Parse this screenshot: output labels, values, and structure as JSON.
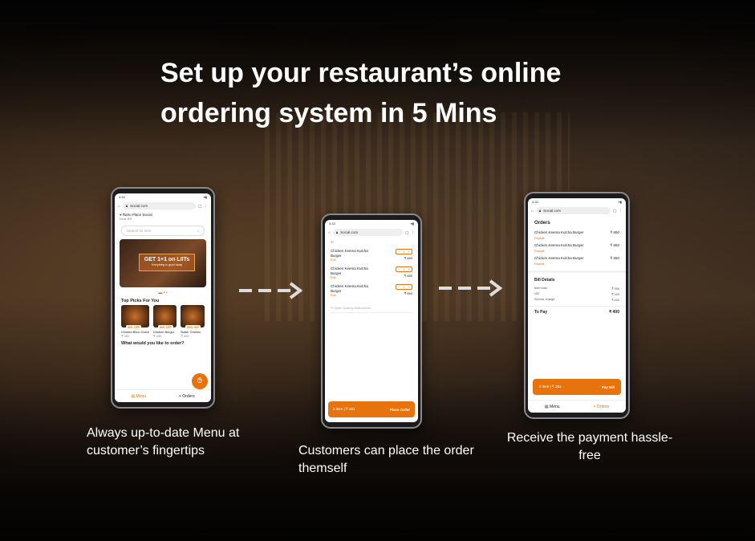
{
  "headline": {
    "line1": "Set up your restaurant’s online",
    "line2": "ordering system in 5 Mins"
  },
  "captions": {
    "step1": "Always up-to-date  Menu at customer’s fingertips",
    "step2": "Customers can place the order themself",
    "step3": "Receive the payment hassle-free"
  },
  "browser": {
    "time": "3:33",
    "url": "Social.com"
  },
  "menu_screen": {
    "location": "Rahu Place Social",
    "location_sub": "Near BR",
    "search_placeholder": "Search for item",
    "banner_title": "GET 1+1 on LIITs",
    "banner_sub": "Everything is good today",
    "top_picks_title": "Top Picks For You",
    "picks": [
      {
        "badge": "50% OFF",
        "name": "Chicken Bhun Gosht",
        "price": "₹ 450"
      },
      {
        "badge": "50% OFF",
        "name": "Chicken Burger",
        "price": "₹ 450"
      },
      {
        "badge": "50% OFF",
        "name": "Butter Chicken",
        "price": "₹ 450"
      }
    ],
    "order_prompt": "What would you like to order?",
    "nav_menu": "Menu",
    "nav_orders": "Orders"
  },
  "cart_screen": {
    "items": [
      {
        "name": "Chicken Keema Kulcha Burger",
        "qty": "1",
        "edit": "Edit",
        "price": "₹ 650"
      },
      {
        "name": "Chicken Keema Kulcha Burger",
        "qty": "1",
        "edit": "Edit",
        "price": "₹ 650"
      },
      {
        "name": "Chicken Keema Kulcha Burger",
        "qty": "1",
        "edit": "Edit",
        "price": "₹ 650"
      }
    ],
    "cooking_placeholder": "Write cooking instructions",
    "bar_summary": "2 item  |  ₹ 261",
    "place_order": "Place Order"
  },
  "orders_screen": {
    "title": "Orders",
    "items": [
      {
        "name": "Chicken Keema Kulcha Burger",
        "price": "₹ 650",
        "repeat": "Repeat"
      },
      {
        "name": "Chicken Keema Kulcha Burger",
        "price": "₹ 650",
        "repeat": "Repeat"
      },
      {
        "name": "Chicken Keema Kulcha Burger",
        "price": "₹ 650",
        "repeat": "Repeat"
      }
    ],
    "bill_title": "Bill Details",
    "bill": [
      {
        "label": "Item total",
        "value": "₹ 950"
      },
      {
        "label": "VAT",
        "value": "₹ 400"
      },
      {
        "label": "Service charge",
        "value": "₹ 400"
      }
    ],
    "to_pay_label": "To Pay",
    "to_pay_value": "₹ 400",
    "bar_summary": "2 item  |  ₹ 261",
    "pay_bill": "Pay Bill",
    "nav_menu": "Menu",
    "nav_orders": "Orders"
  },
  "colors": {
    "accent": "#e8730c"
  }
}
